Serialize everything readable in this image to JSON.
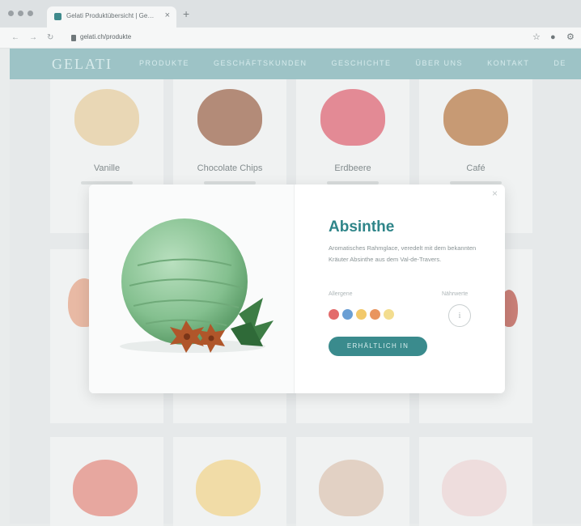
{
  "browser": {
    "tab_title": "Gelati Produktübersicht | Gelati",
    "tab_close": "×",
    "new_tab": "+",
    "url": "gelati.ch/produkte",
    "icons": [
      "back-arrow-icon",
      "forward-arrow-icon",
      "reload-icon",
      "lock-icon",
      "star-icon",
      "account-icon",
      "settings-icon"
    ]
  },
  "site": {
    "logo": "GELATI",
    "nav": [
      "PRODUKTE",
      "GESCHÄFTSKUNDEN",
      "GESCHICHTE",
      "ÜBER UNS",
      "KONTAKT",
      "DE"
    ]
  },
  "products": [
    {
      "name": "Vanille",
      "color": "#e9d7b5"
    },
    {
      "name": "Chocolate Chips",
      "color": "#b38b78"
    },
    {
      "name": "Erdbeere",
      "color": "#e38a95"
    },
    {
      "name": "Café",
      "color": "#c79a74"
    }
  ],
  "bottom_scoop_colors": [
    "#e7a79f",
    "#f1dca7",
    "#e2d1c4",
    "#eedddd"
  ],
  "modal": {
    "title": "Absinthe",
    "description": "Aromatisches Rahmglace, veredelt mit dem bekannten Kräuter Absinthe aus dem Val-de-Travers.",
    "allergens_label": "Allergene",
    "info_label": "Nährwerte",
    "info_symbol": "i",
    "close_symbol": "×",
    "cta_label": "ERHÄLTLICH IN",
    "allergen_colors": [
      "#e36b6b",
      "#6a9fd4",
      "#f2c96b",
      "#e9955f",
      "#f3dd8f"
    ],
    "scoop_color": "#8fc79a"
  }
}
